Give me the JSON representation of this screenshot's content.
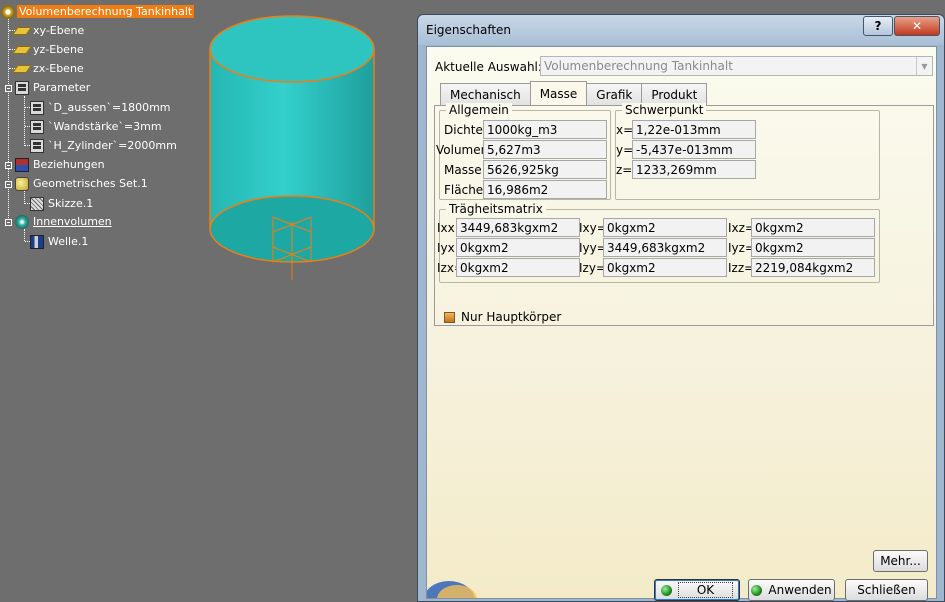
{
  "tree": {
    "items": [
      {
        "label": "Volumenberechnung Tankinhalt",
        "icon": "part-gear-icon"
      },
      {
        "label": "xy-Ebene",
        "icon": "plane-icon"
      },
      {
        "label": "yz-Ebene",
        "icon": "plane-icon"
      },
      {
        "label": "zx-Ebene",
        "icon": "plane-icon"
      },
      {
        "label": "Parameter",
        "icon": "parameter-icon"
      },
      {
        "label": "`D_aussen`=1800mm",
        "icon": "parameter-value-icon"
      },
      {
        "label": "`Wandstärke`=3mm",
        "icon": "parameter-value-icon"
      },
      {
        "label": "`H_Zylinder`=2000mm",
        "icon": "parameter-value-icon"
      },
      {
        "label": "Beziehungen",
        "icon": "relations-icon"
      },
      {
        "label": "Geometrisches Set.1",
        "icon": "geometrical-set-icon"
      },
      {
        "label": "Skizze.1",
        "icon": "sketch-icon"
      },
      {
        "label": "Innenvolumen",
        "icon": "body-icon"
      },
      {
        "label": "Welle.1",
        "icon": "shaft-icon"
      }
    ]
  },
  "viewport": {
    "tank_color": "#2ec4c0",
    "edge_color": "#f07d12",
    "background": "#6e6e6e"
  },
  "dialog": {
    "title": "Eigenschaften",
    "help_label": "?",
    "close_label": "✕",
    "current_selection_label": "Aktuelle Auswahl:",
    "current_selection_value": "Volumenberechnung Tankinhalt",
    "tabs": [
      {
        "label": "Mechanisch",
        "active": false
      },
      {
        "label": "Masse",
        "active": true
      },
      {
        "label": "Grafik",
        "active": false
      },
      {
        "label": "Produkt",
        "active": false
      }
    ],
    "general": {
      "title": "Allgemein",
      "density_label": "Dichte:",
      "density_value": "1000kg_m3",
      "volume_label": "Volumen:",
      "volume_value": "5,627m3",
      "mass_label": "Masse:",
      "mass_value": "5626,925kg",
      "area_label": "Fläche:",
      "area_value": "16,986m2"
    },
    "centroid": {
      "title": "Schwerpunkt",
      "x_label": "x=",
      "x_value": "1,22e-013mm",
      "y_label": "y=",
      "y_value": "-5,437e-013mm",
      "z_label": "z=",
      "z_value": "1233,269mm"
    },
    "inertia": {
      "title": "Trägheitsmatrix",
      "ixx_label": "Ixx=",
      "ixx_value": "3449,683kgxm2",
      "ixy_label": "Ixy=",
      "ixy_value": "0kgxm2",
      "ixz_label": "Ixz=",
      "ixz_value": "0kgxm2",
      "iyx_label": "Iyx=",
      "iyx_value": "0kgxm2",
      "iyy_label": "Iyy=",
      "iyy_value": "3449,683kgxm2",
      "iyz_label": "Iyz=",
      "iyz_value": "0kgxm2",
      "izx_label": "Izx=",
      "izx_value": "0kgxm2",
      "izy_label": "Izy=",
      "izy_value": "0kgxm2",
      "izz_label": "Izz=",
      "izz_value": "2219,084kgxm2"
    },
    "main_body_only_label": "Nur Hauptkörper",
    "more_button": "Mehr...",
    "ok_button": "OK",
    "apply_button": "Anwenden",
    "close_button": "Schließen"
  }
}
